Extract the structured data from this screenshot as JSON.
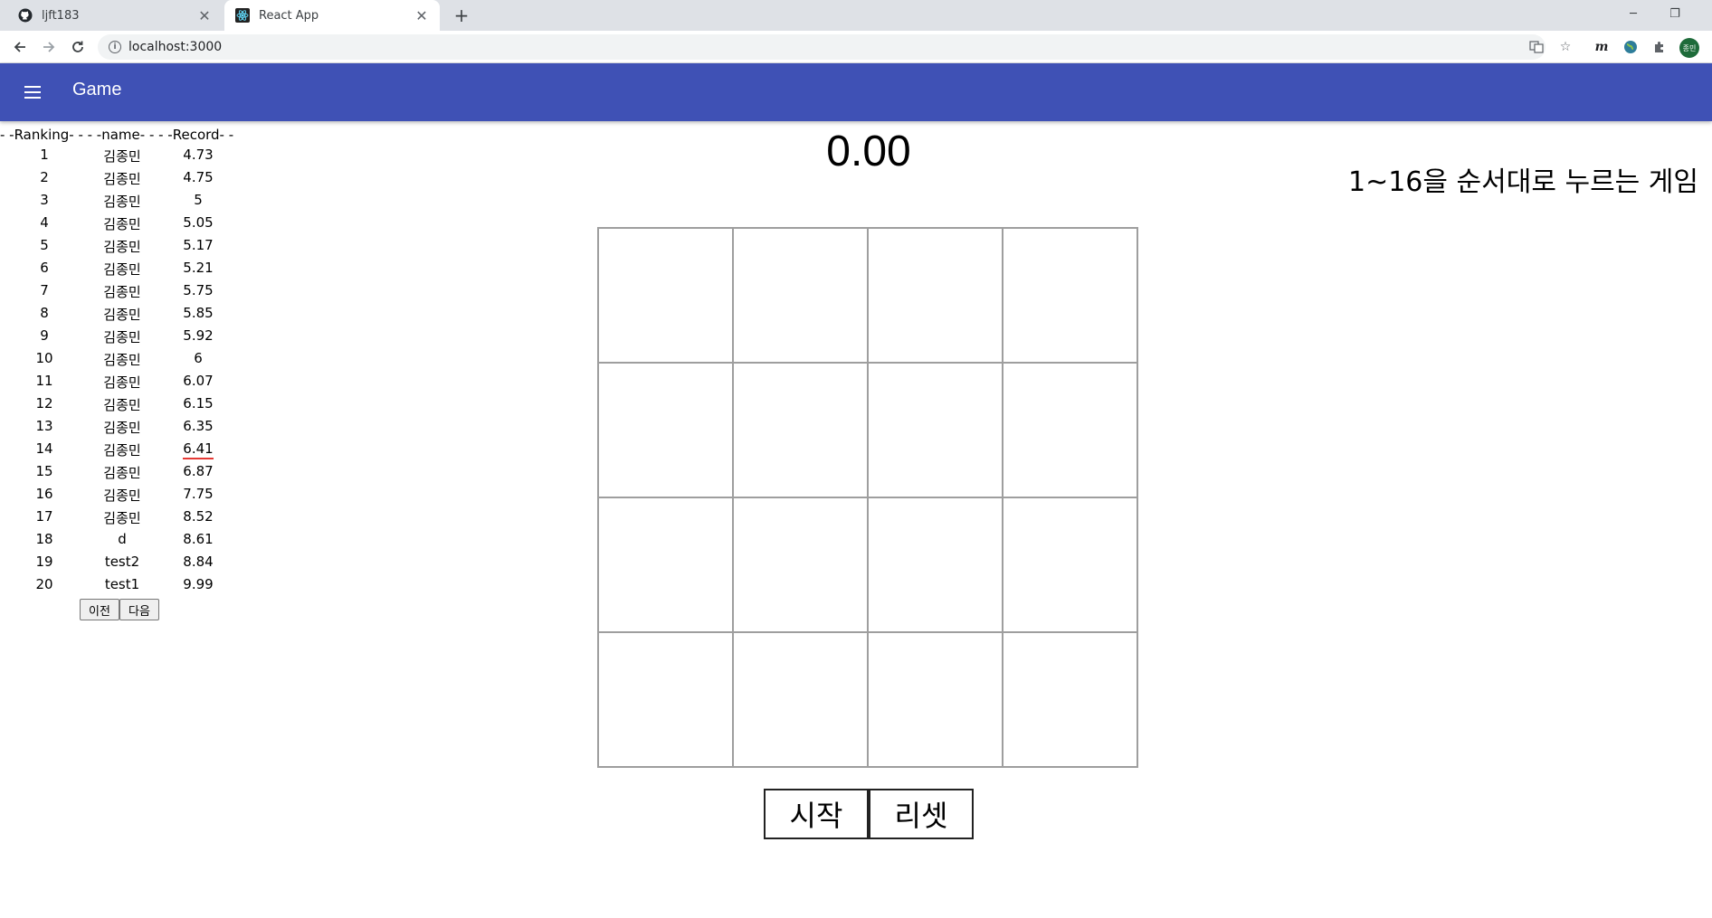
{
  "browser": {
    "tabs": [
      {
        "title": "ljft183",
        "icon": "github-icon"
      },
      {
        "title": "React App",
        "icon": "react-icon"
      }
    ],
    "url": "localhost:3000",
    "profile_initials": "종민"
  },
  "appbar": {
    "title": "Game",
    "color": "#3f51b5"
  },
  "ranking": {
    "header": "- -Ranking- - - -name- - - -Record- -",
    "rows": [
      {
        "rank": "1",
        "name": "김종민",
        "record": "4.73"
      },
      {
        "rank": "2",
        "name": "김종민",
        "record": "4.75"
      },
      {
        "rank": "3",
        "name": "김종민",
        "record": "5"
      },
      {
        "rank": "4",
        "name": "김종민",
        "record": "5.05"
      },
      {
        "rank": "5",
        "name": "김종민",
        "record": "5.17"
      },
      {
        "rank": "6",
        "name": "김종민",
        "record": "5.21"
      },
      {
        "rank": "7",
        "name": "김종민",
        "record": "5.75"
      },
      {
        "rank": "8",
        "name": "김종민",
        "record": "5.85"
      },
      {
        "rank": "9",
        "name": "김종민",
        "record": "5.92"
      },
      {
        "rank": "10",
        "name": "김종민",
        "record": "6"
      },
      {
        "rank": "11",
        "name": "김종민",
        "record": "6.07"
      },
      {
        "rank": "12",
        "name": "김종민",
        "record": "6.15"
      },
      {
        "rank": "13",
        "name": "김종민",
        "record": "6.35"
      },
      {
        "rank": "14",
        "name": "김종민",
        "record": "6.41"
      },
      {
        "rank": "15",
        "name": "김종민",
        "record": "6.87"
      },
      {
        "rank": "16",
        "name": "김종민",
        "record": "7.75"
      },
      {
        "rank": "17",
        "name": "김종민",
        "record": "8.52"
      },
      {
        "rank": "18",
        "name": "d",
        "record": "8.61"
      },
      {
        "rank": "19",
        "name": "test2",
        "record": "8.84"
      },
      {
        "rank": "20",
        "name": "test1",
        "record": "9.99"
      }
    ],
    "prev_label": "이전",
    "next_label": "다음"
  },
  "game": {
    "timer": "0.00",
    "description": "1~16을 순서대로 누르는 게임",
    "start_label": "시작",
    "reset_label": "리셋"
  }
}
